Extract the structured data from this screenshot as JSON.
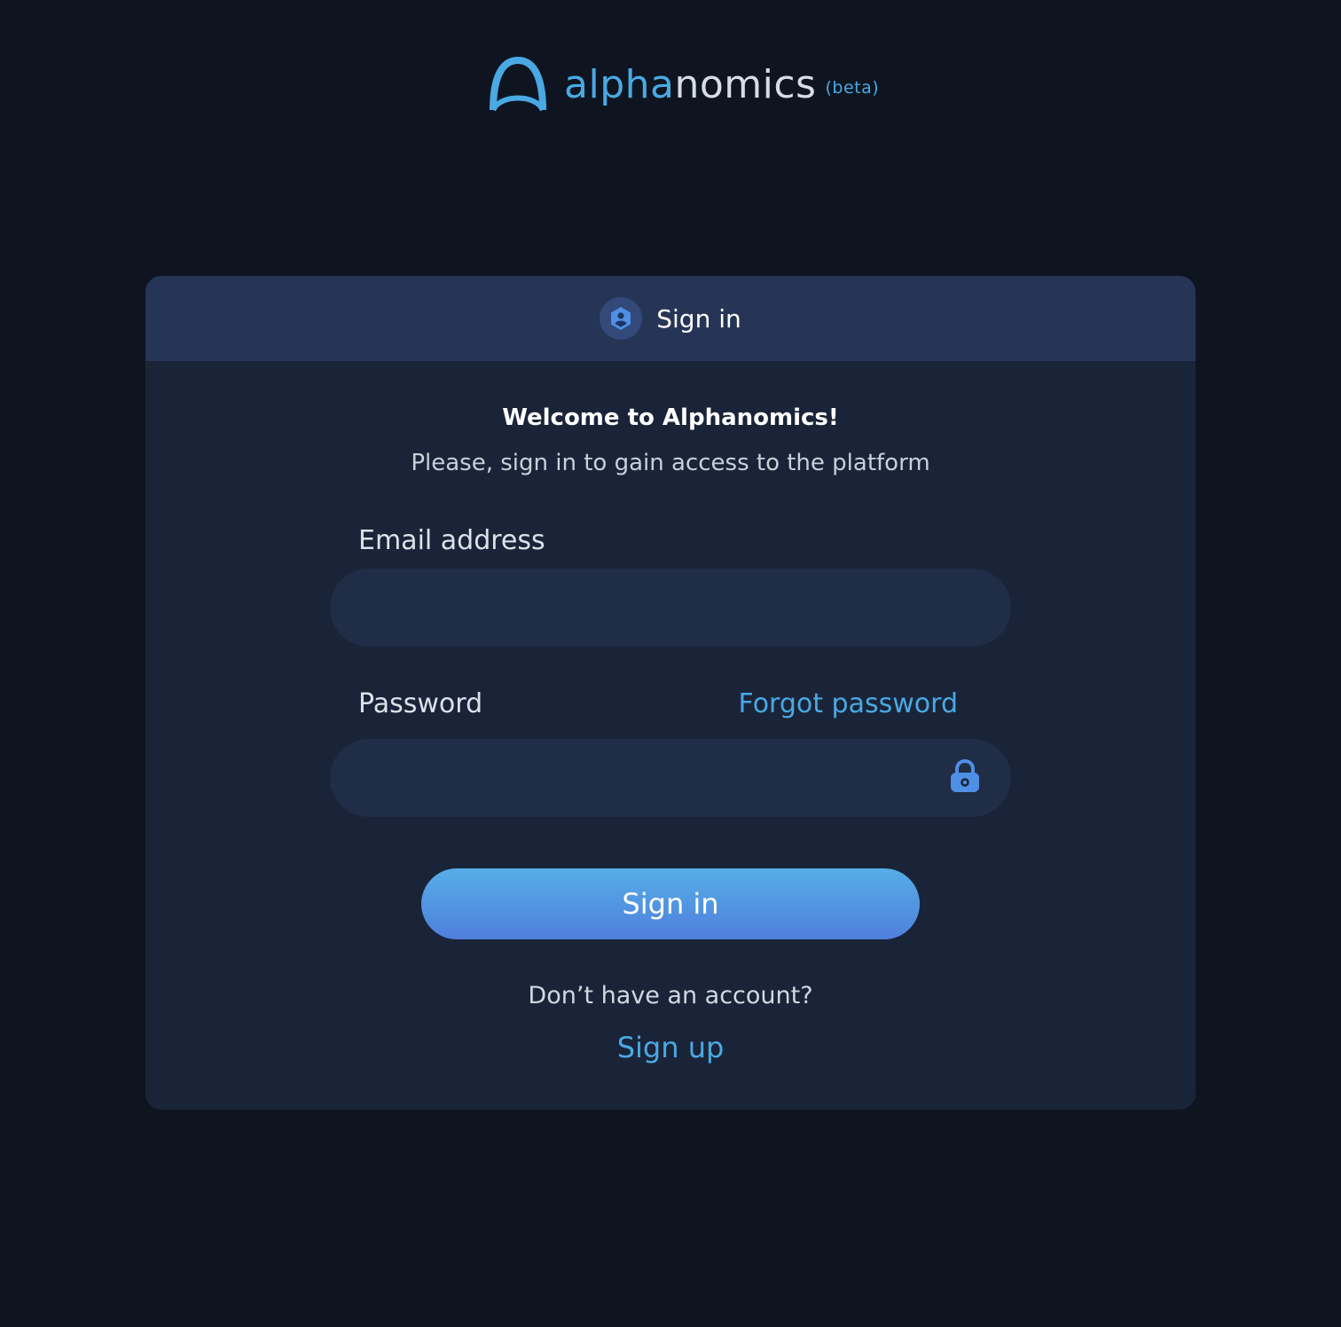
{
  "brand": {
    "name_part1": "alpha",
    "name_part2": "nomics",
    "tag": "(beta)",
    "logo_icon": "arch-logo",
    "colors": {
      "accent": "#4aa9e3",
      "text": "#d7dde5"
    }
  },
  "card": {
    "header": {
      "icon": "user-hexagon-icon",
      "title": "Sign in"
    },
    "welcome": "Welcome to Alphanomics!",
    "subtitle": "Please, sign in to gain access to the platform",
    "email": {
      "label": "Email address",
      "value": "",
      "placeholder": ""
    },
    "password": {
      "label": "Password",
      "value": "",
      "placeholder": "",
      "forgot_label": "Forgot password",
      "icon": "lock-icon"
    },
    "signin_button": "Sign in",
    "no_account": "Don’t have an account?",
    "signup_link": "Sign up"
  },
  "colors": {
    "background": "#0e1521",
    "card": "#1a2438",
    "card_header": "#263556",
    "input": "#202d46",
    "button_top": "#56aee6",
    "button_bottom": "#4f7fdd",
    "link": "#4aa9e3"
  }
}
